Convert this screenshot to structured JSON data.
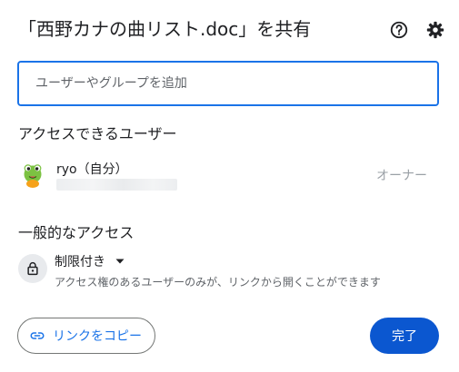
{
  "dialog": {
    "title": "「西野カナの曲リスト.doc」を共有",
    "icons": {
      "help": "help-circle-icon",
      "settings": "gear-icon"
    }
  },
  "add_people": {
    "placeholder": "ユーザーやグループを追加",
    "value": ""
  },
  "people_section": {
    "title": "アクセスできるユーザー",
    "users": [
      {
        "name": "ryo（自分）",
        "role": "オーナー",
        "avatar": "frog-avatar"
      }
    ]
  },
  "general_access": {
    "title": "一般的なアクセス",
    "selected": "制限付き",
    "description": "アクセス権のあるユーザーのみが、リンクから開くことができます",
    "icon": "lock-icon"
  },
  "footer": {
    "copy_link_label": "リンクをコピー",
    "done_label": "完了"
  },
  "colors": {
    "accent": "#1a73e8",
    "primary_button": "#0b57d0"
  }
}
